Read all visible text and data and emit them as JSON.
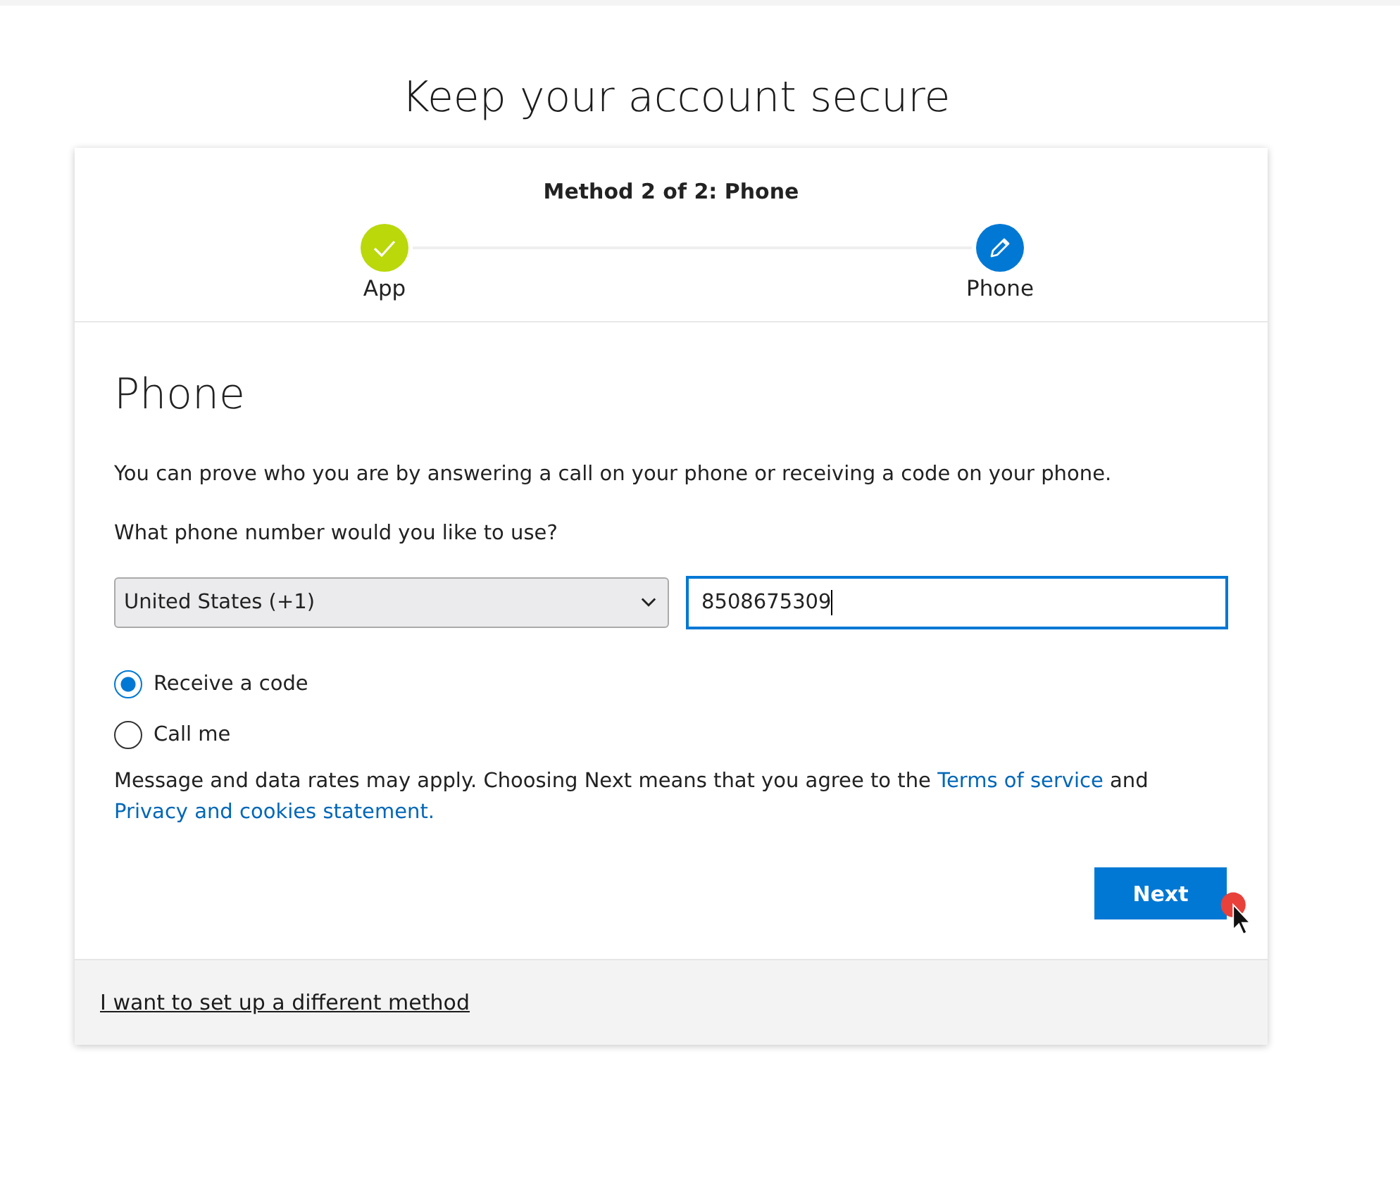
{
  "page_title": "Keep your account secure",
  "progress": {
    "caption": "Method 2 of 2: Phone",
    "steps": [
      {
        "label": "App",
        "kind": "done"
      },
      {
        "label": "Phone",
        "kind": "current"
      }
    ]
  },
  "section_title": "Phone",
  "intro": "You can prove who you are by answering a call on your phone or receiving a code on your phone.",
  "question": "What phone number would you like to use?",
  "country_select": {
    "value": "United States (+1)"
  },
  "phone_field": {
    "value": "8508675309",
    "focused": true
  },
  "options": [
    {
      "label": "Receive a code",
      "selected": true
    },
    {
      "label": "Call me",
      "selected": false
    }
  ],
  "disclaimer": [
    {
      "kind": "text",
      "text": "Message and data rates may apply. Choosing Next means that you agree to the "
    },
    {
      "kind": "link",
      "text": "Terms of service"
    },
    {
      "kind": "text",
      "text": " and "
    },
    {
      "kind": "link",
      "text": "Privacy and cookies statement."
    }
  ],
  "next_button": "Next",
  "footer_link": "I want to set up a different method"
}
